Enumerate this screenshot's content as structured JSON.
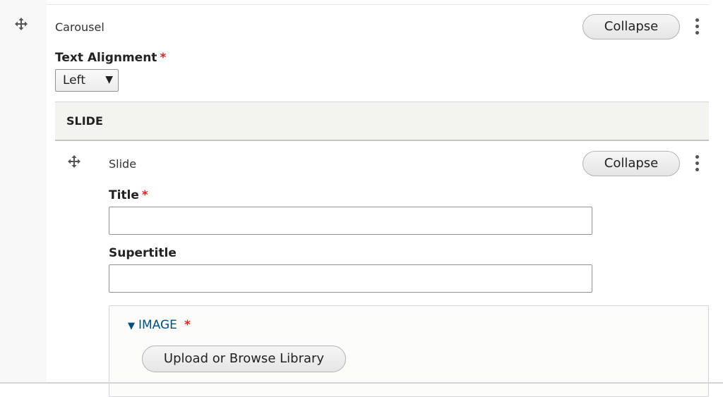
{
  "carousel": {
    "label": "Carousel",
    "collapse_label": "Collapse",
    "drag_icon": "move-arrows-icon",
    "menu_icon": "kebab-menu-icon",
    "text_alignment": {
      "label": "Text Alignment",
      "required_mark": "*",
      "selected": "Left",
      "caret": "▼"
    },
    "section_title": "SLIDE"
  },
  "slide": {
    "label": "Slide",
    "collapse_label": "Collapse",
    "title_field": {
      "label": "Title",
      "required_mark": "*",
      "value": ""
    },
    "supertitle_field": {
      "label": "Supertitle",
      "value": ""
    },
    "image": {
      "summary": "IMAGE",
      "toggle_glyph": "▼",
      "required_mark": "*",
      "upload_label": "Upload or Browse Library"
    }
  },
  "colors": {
    "required": "#dc2323",
    "link": "#004f80",
    "section_bg": "#f3f3f0"
  }
}
